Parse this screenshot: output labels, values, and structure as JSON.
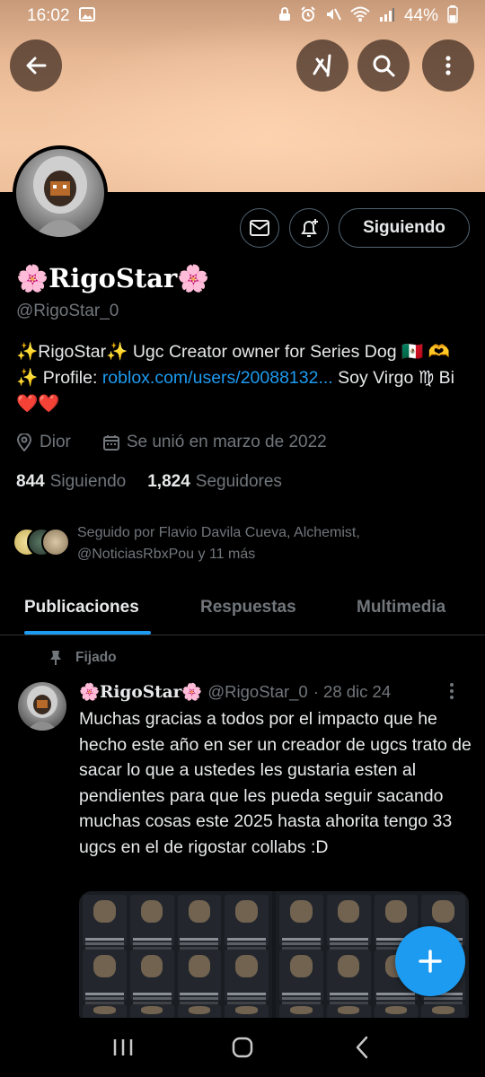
{
  "status_bar": {
    "time": "16:02",
    "battery": "44%",
    "icons": [
      "gallery-icon",
      "lock-icon",
      "alarm-icon",
      "mute-icon",
      "wifi-icon",
      "signal-icon",
      "battery-icon"
    ]
  },
  "header_buttons": [
    "back-arrow-icon",
    "grok-icon",
    "search-icon",
    "more-vertical-icon"
  ],
  "profile": {
    "display_name": "🌸RigoStar🌸",
    "handle": "@RigoStar_0",
    "follow_button": "Siguiendo",
    "bio_part1": "✨RigoStar✨ Ugc Creator owner for Series Dog 🇲🇽 🫶 ✨ Profile: ",
    "bio_link": "roblox.com/users/20088132...",
    "bio_part2": " Soy Virgo ♍ Bi❤️❤️",
    "location": "Dior",
    "joined": "Se unió en marzo de 2022",
    "following_count": "844",
    "following_label": "Siguiendo",
    "followers_count": "1,824",
    "followers_label": "Seguidores",
    "followed_by_line1": "Seguido por Flavio Davila Cueva, Alchemist,",
    "followed_by_line2": "@NoticiasRbxPou y 11 más"
  },
  "tabs": [
    {
      "label": "Publicaciones",
      "active": true
    },
    {
      "label": "Respuestas",
      "active": false
    },
    {
      "label": "Multimedia",
      "active": false
    }
  ],
  "post": {
    "pinned_label": "Fijado",
    "author": "🌸RigoStar🌸",
    "handle": "@RigoStar_0",
    "date": "· 28 dic 24",
    "text": "Muchas gracias a todos por el impacto que he hecho este año en ser un creador de ugcs trato de sacar lo que a ustedes les gustaria esten al pendientes para que les pueda seguir sacando muchas cosas este 2025 hasta ahorita tengo 33 ugcs en el de rigostar collabs :D"
  },
  "nav": [
    "recents-icon",
    "home-icon",
    "back-icon"
  ],
  "colors": {
    "accent": "#1d9bf0",
    "secondary_text": "#71767b",
    "background": "#000000"
  }
}
